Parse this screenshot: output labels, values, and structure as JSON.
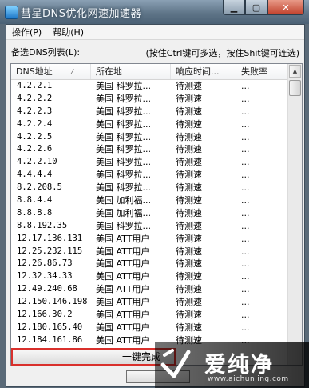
{
  "window": {
    "title": "彗星DNS优化网速加速器",
    "minimize": "▁",
    "maximize": "▢",
    "close": "✕"
  },
  "menu": [
    {
      "label": "操作(P)"
    },
    {
      "label": "帮助(H)"
    }
  ],
  "list_label": "备选DNS列表(L):",
  "hint": "(按住Ctrl键可多选，按住Shit键可连选)",
  "columns": [
    "DNS地址",
    "所在地",
    "响应时间...",
    "失败率"
  ],
  "rows": [
    {
      "dns": "4.2.2.1",
      "location": "美国 科罗拉...",
      "response": "待测速",
      "fail": "..."
    },
    {
      "dns": "4.2.2.2",
      "location": "美国 科罗拉...",
      "response": "待测速",
      "fail": "..."
    },
    {
      "dns": "4.2.2.3",
      "location": "美国 科罗拉...",
      "response": "待测速",
      "fail": "..."
    },
    {
      "dns": "4.2.2.4",
      "location": "美国 科罗拉...",
      "response": "待测速",
      "fail": "..."
    },
    {
      "dns": "4.2.2.5",
      "location": "美国 科罗拉...",
      "response": "待测速",
      "fail": "..."
    },
    {
      "dns": "4.2.2.6",
      "location": "美国 科罗拉...",
      "response": "待测速",
      "fail": "..."
    },
    {
      "dns": "4.2.2.10",
      "location": "美国 科罗拉...",
      "response": "待测速",
      "fail": "..."
    },
    {
      "dns": "4.4.4.4",
      "location": "美国 科罗拉...",
      "response": "待测速",
      "fail": "..."
    },
    {
      "dns": "8.2.208.5",
      "location": "美国 科罗拉...",
      "response": "待测速",
      "fail": "..."
    },
    {
      "dns": "8.8.4.4",
      "location": "美国 加利福...",
      "response": "待测速",
      "fail": "..."
    },
    {
      "dns": "8.8.8.8",
      "location": "美国 加利福...",
      "response": "待测速",
      "fail": "..."
    },
    {
      "dns": "8.8.192.35",
      "location": "美国 科罗拉...",
      "response": "待测速",
      "fail": "..."
    },
    {
      "dns": "12.17.136.131",
      "location": "美国 ATT用户",
      "response": "待测速",
      "fail": "..."
    },
    {
      "dns": "12.25.232.115",
      "location": "美国 ATT用户",
      "response": "待测速",
      "fail": "..."
    },
    {
      "dns": "12.26.86.73",
      "location": "美国 ATT用户",
      "response": "待测速",
      "fail": "..."
    },
    {
      "dns": "12.32.34.33",
      "location": "美国 ATT用户",
      "response": "待测速",
      "fail": "..."
    },
    {
      "dns": "12.49.240.68",
      "location": "美国 ATT用户",
      "response": "待测速",
      "fail": "..."
    },
    {
      "dns": "12.150.146.198",
      "location": "美国 ATT用户",
      "response": "待测速",
      "fail": "..."
    },
    {
      "dns": "12.166.30.2",
      "location": "美国 ATT用户",
      "response": "待测速",
      "fail": "..."
    },
    {
      "dns": "12.180.165.40",
      "location": "美国 ATT用户",
      "response": "待测速",
      "fail": "..."
    },
    {
      "dns": "12.184.161.86",
      "location": "美国 ATT用户",
      "response": "待测速",
      "fail": "..."
    }
  ],
  "one_click_button": "一键完成",
  "watermark": {
    "text": "爱纯净",
    "url": "www.aichunjing.com"
  },
  "colors": {
    "highlight": "#d9302c",
    "title_bar": "#5f7588"
  }
}
